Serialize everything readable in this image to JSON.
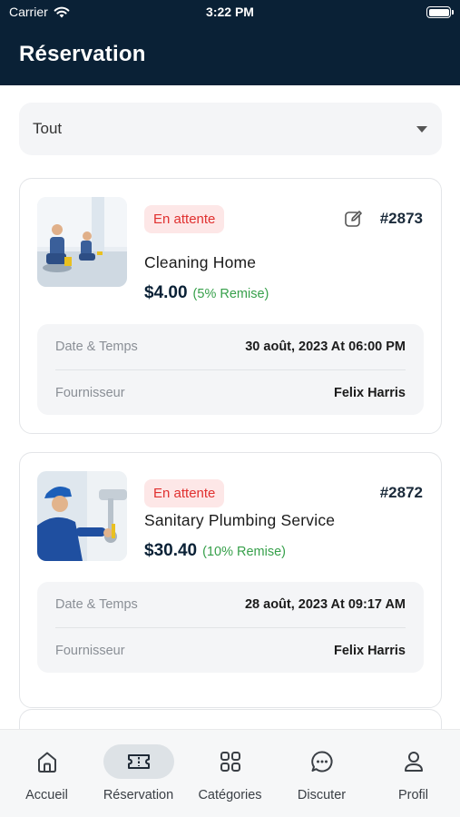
{
  "status_bar": {
    "carrier": "Carrier",
    "time": "3:22 PM"
  },
  "header": {
    "title": "Réservation"
  },
  "filter": {
    "selected": "Tout"
  },
  "bookings": [
    {
      "status": "En attente",
      "id": "#2873",
      "service": "Cleaning Home",
      "price": "$4.00",
      "discount": "(5% Remise)",
      "date_label": "Date & Temps",
      "date_value": "30 août, 2023 At 06:00 PM",
      "provider_label": "Fournisseur",
      "provider_value": "Felix Harris"
    },
    {
      "status": "En attente",
      "id": "#2872",
      "service": "Sanitary Plumbing Service",
      "price": "$30.40",
      "discount": "(10% Remise)",
      "date_label": "Date & Temps",
      "date_value": "28 août, 2023 At 09:17 AM",
      "provider_label": "Fournisseur",
      "provider_value": "Felix Harris"
    }
  ],
  "tabs": [
    {
      "label": "Accueil",
      "icon": "home-icon"
    },
    {
      "label": "Réservation",
      "icon": "ticket-icon"
    },
    {
      "label": "Catégories",
      "icon": "grid-icon"
    },
    {
      "label": "Discuter",
      "icon": "chat-icon"
    },
    {
      "label": "Profil",
      "icon": "user-icon"
    }
  ],
  "colors": {
    "header_bg": "#0a2136",
    "badge_bg": "#fde7e7",
    "badge_text": "#e0302f",
    "discount": "#37a04b"
  }
}
